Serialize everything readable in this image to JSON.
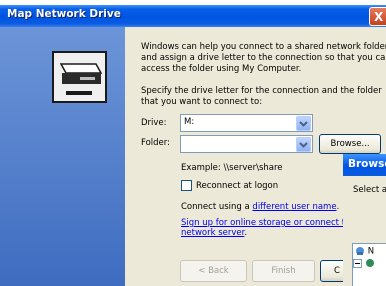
{
  "window": {
    "title": "Map Network Drive",
    "close_glyph": "X"
  },
  "intro_text": [
    "Windows can help you connect to a shared network folder",
    "and assign a drive letter to the connection so that you can",
    "access the folder using My Computer."
  ],
  "specify_text": [
    "Specify the drive letter for the connection and the folder",
    "that you want to connect to:"
  ],
  "drive": {
    "label": "Drive:",
    "value": "M:"
  },
  "folder": {
    "label": "Folder:",
    "value": "",
    "browse_label": "Browse..."
  },
  "example_text": "Example: \\\\server\\share",
  "reconnect": {
    "label": "Reconnect at logon",
    "checked": false
  },
  "connect_prefix": "Connect using a ",
  "connect_link": "different user name",
  "connect_suffix": ".",
  "signup_link_lines": [
    "Sign up for online storage or connect to",
    "network server"
  ],
  "signup_suffix": ".",
  "buttons": {
    "back": "< Back",
    "finish": "Finish",
    "cancel": "C"
  },
  "browse_dialog": {
    "title": "Browse",
    "text": "Select a",
    "tree_items": [
      "N",
      ""
    ]
  },
  "colors": {
    "title_blue": "#0054e3",
    "panel_blue": "#3f6cc0",
    "dialog_bg": "#ece9d8",
    "link": "#0000ee"
  },
  "icons": [
    "network-drive-icon",
    "dropdown-arrow-icon",
    "close-icon",
    "network-places-icon"
  ]
}
